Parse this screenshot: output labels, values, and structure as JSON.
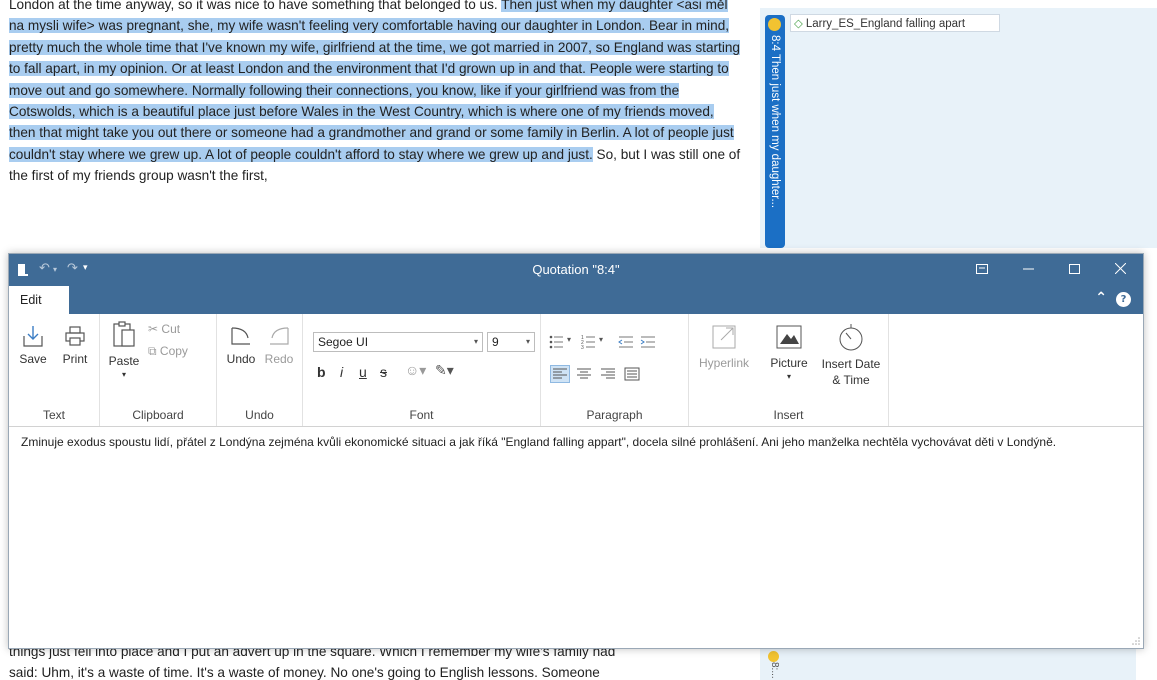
{
  "document": {
    "plain_before": "London at the time anyway, so it was nice to have something that belonged to us. ",
    "highlighted": "Then just when my daughter <asi měl na mysli wife> was pregnant, she, my wife wasn't feeling very comfortable having our daughter in London. Bear in mind, pretty much the whole time that I've known my wife, girlfriend at the time, we got married in 2007, so England was starting to fall apart, in my opinion. Or at least London and the environment that I'd grown up in and that. People were starting to move out and go somewhere. Normally following  their connections, you know, like if your girlfriend was from the Cotswolds, which is a beautiful place just before Wales in the West Country, which is where one of my friends moved, then that might take you out there or someone had a grandmother and grand or some family in Berlin. A lot of people just couldn't stay where we grew up. A lot of people couldn't afford to stay where we grew up and just.",
    "plain_after": " So, but I was still one of the first of my friends group wasn't the first,",
    "bottom_line_1": "things just fell into place and I put an advert up in the square. Which I remember my wife's family had",
    "bottom_line_2": "said: Uhm, it's a waste of time. It's a waste of money. No one's going to English lessons. Someone"
  },
  "margin": {
    "quotation_label": "8:4 Then just when my daughter...",
    "code_label": "Larry_ES_England falling apart",
    "mini_label": "8:..."
  },
  "dialog": {
    "title": "Quotation \"8:4\"",
    "tab": "Edit",
    "groups": {
      "text": {
        "label": "Text",
        "save": "Save",
        "print": "Print"
      },
      "clipboard": {
        "label": "Clipboard",
        "paste": "Paste",
        "cut": "Cut",
        "copy": "Copy"
      },
      "undo": {
        "label": "Undo",
        "undo": "Undo",
        "redo": "Redo"
      },
      "font": {
        "label": "Font",
        "family": "Segoe UI",
        "size": "9",
        "bold": "b",
        "italic": "i",
        "underline": "u",
        "strike": "s"
      },
      "paragraph": {
        "label": "Paragraph"
      },
      "insert": {
        "label": "Insert",
        "hyperlink": "Hyperlink",
        "picture": "Picture",
        "insert_date": "Insert Date",
        "insert_time": "& Time"
      }
    },
    "comment": "Zminuje exodus spoustu lidí, přátel z Londýna zejména kvůli ekonomické situaci a jak říká \"England falling appart\", docela silné prohlášení. Ani jeho manželka nechtěla vychovávat děti v Londýně."
  },
  "colors": {
    "titlebar": "#3f6b96",
    "highlight": "#a9cdf0",
    "quote_bar": "#1b6fc5",
    "margin_bg": "#e8f2f9"
  }
}
